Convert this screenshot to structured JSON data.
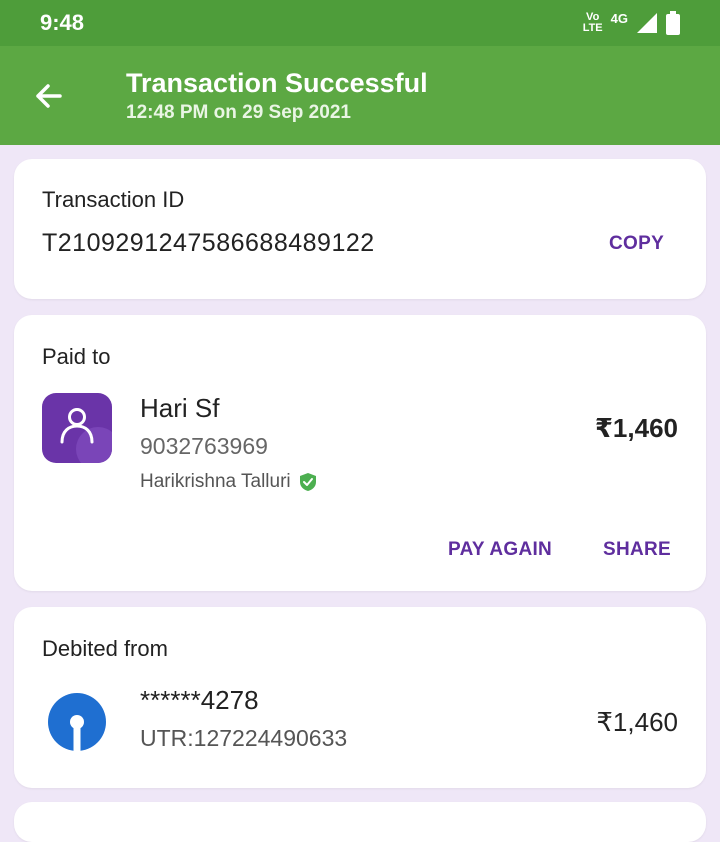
{
  "status_bar": {
    "time": "9:48",
    "volte_top": "Vo",
    "volte_bottom": "LTE",
    "network": "4G"
  },
  "header": {
    "title": "Transaction Successful",
    "subtitle": "12:48 PM on 29 Sep 2021"
  },
  "transaction": {
    "label": "Transaction ID",
    "id": "T2109291247586688489122",
    "copy_label": "COPY"
  },
  "paid_to": {
    "label": "Paid to",
    "name": "Hari Sf",
    "phone": "9032763969",
    "registered_name": "Harikrishna Talluri",
    "amount": "₹1,460",
    "pay_again_label": "PAY AGAIN",
    "share_label": "SHARE"
  },
  "debited_from": {
    "label": "Debited from",
    "account": "******4278",
    "utr": "UTR:127224490633",
    "amount": "₹1,460"
  },
  "colors": {
    "status_bar": "#4e9d3a",
    "app_bar": "#5ca843",
    "accent": "#5f2e9e",
    "background": "#efe7f7",
    "verified": "#4caf50",
    "bank_blue": "#1f6fd1"
  }
}
